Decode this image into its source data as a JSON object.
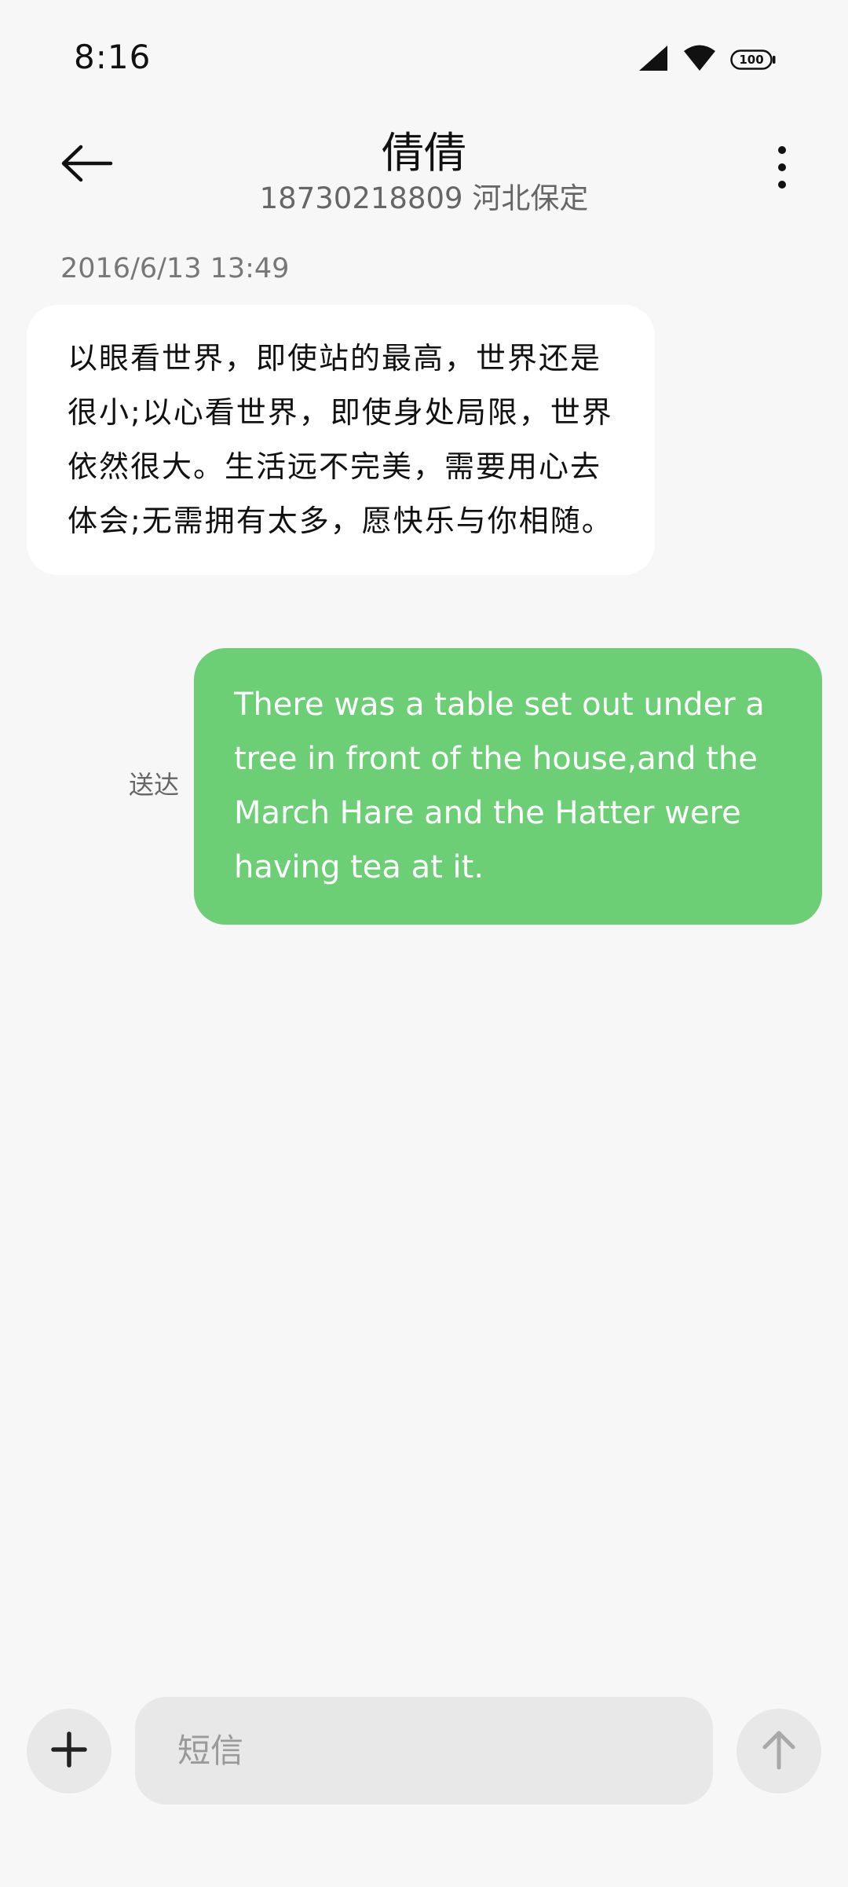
{
  "status_bar": {
    "time": "8:16",
    "battery": "100",
    "icons": [
      "signal-icon",
      "wifi-icon",
      "battery-icon"
    ]
  },
  "header": {
    "contact_name": "倩倩",
    "contact_detail": "18730218809 河北保定",
    "icons": [
      "back-arrow-icon",
      "more-vert-icon"
    ]
  },
  "conversation": {
    "timestamp": "2016/6/13 13:49",
    "messages": [
      {
        "direction": "incoming",
        "text": "以眼看世界，即使站的最高，世界还是很小;以心看世界，即使身处局限，世界依然很大。生活远不完美，需要用心去体会;无需拥有太多，愿快乐与你相随。"
      },
      {
        "direction": "outgoing",
        "text": "There was a table set out under a tree in front of the house,and the March Hare and the Hatter were having tea at it.",
        "status": "送达"
      }
    ]
  },
  "composer": {
    "placeholder": "短信",
    "value": "",
    "icons": [
      "plus-icon",
      "send-arrow-icon"
    ]
  },
  "colors": {
    "background": "#f7f7f7",
    "incoming_bubble": "#ffffff",
    "outgoing_bubble": "#6ccf75",
    "input_background": "#e8e8e8"
  }
}
